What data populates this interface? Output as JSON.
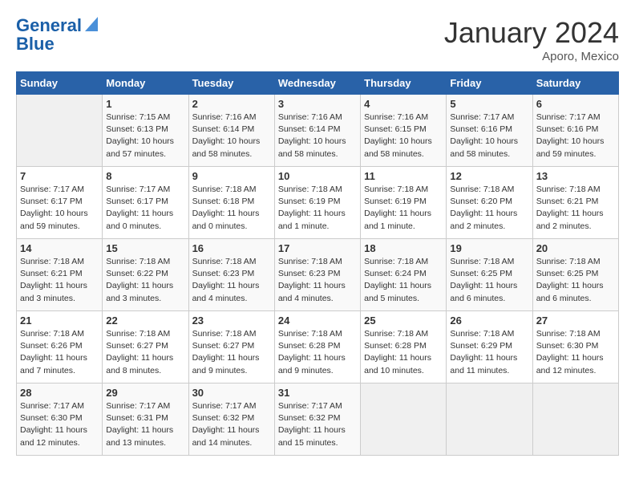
{
  "header": {
    "logo_line1": "General",
    "logo_line2": "Blue",
    "month": "January 2024",
    "location": "Aporo, Mexico"
  },
  "days_of_week": [
    "Sunday",
    "Monday",
    "Tuesday",
    "Wednesday",
    "Thursday",
    "Friday",
    "Saturday"
  ],
  "weeks": [
    [
      {
        "num": "",
        "info": ""
      },
      {
        "num": "1",
        "info": "Sunrise: 7:15 AM\nSunset: 6:13 PM\nDaylight: 10 hours\nand 57 minutes."
      },
      {
        "num": "2",
        "info": "Sunrise: 7:16 AM\nSunset: 6:14 PM\nDaylight: 10 hours\nand 58 minutes."
      },
      {
        "num": "3",
        "info": "Sunrise: 7:16 AM\nSunset: 6:14 PM\nDaylight: 10 hours\nand 58 minutes."
      },
      {
        "num": "4",
        "info": "Sunrise: 7:16 AM\nSunset: 6:15 PM\nDaylight: 10 hours\nand 58 minutes."
      },
      {
        "num": "5",
        "info": "Sunrise: 7:17 AM\nSunset: 6:16 PM\nDaylight: 10 hours\nand 58 minutes."
      },
      {
        "num": "6",
        "info": "Sunrise: 7:17 AM\nSunset: 6:16 PM\nDaylight: 10 hours\nand 59 minutes."
      }
    ],
    [
      {
        "num": "7",
        "info": "Sunrise: 7:17 AM\nSunset: 6:17 PM\nDaylight: 10 hours\nand 59 minutes."
      },
      {
        "num": "8",
        "info": "Sunrise: 7:17 AM\nSunset: 6:17 PM\nDaylight: 11 hours\nand 0 minutes."
      },
      {
        "num": "9",
        "info": "Sunrise: 7:18 AM\nSunset: 6:18 PM\nDaylight: 11 hours\nand 0 minutes."
      },
      {
        "num": "10",
        "info": "Sunrise: 7:18 AM\nSunset: 6:19 PM\nDaylight: 11 hours\nand 1 minute."
      },
      {
        "num": "11",
        "info": "Sunrise: 7:18 AM\nSunset: 6:19 PM\nDaylight: 11 hours\nand 1 minute."
      },
      {
        "num": "12",
        "info": "Sunrise: 7:18 AM\nSunset: 6:20 PM\nDaylight: 11 hours\nand 2 minutes."
      },
      {
        "num": "13",
        "info": "Sunrise: 7:18 AM\nSunset: 6:21 PM\nDaylight: 11 hours\nand 2 minutes."
      }
    ],
    [
      {
        "num": "14",
        "info": "Sunrise: 7:18 AM\nSunset: 6:21 PM\nDaylight: 11 hours\nand 3 minutes."
      },
      {
        "num": "15",
        "info": "Sunrise: 7:18 AM\nSunset: 6:22 PM\nDaylight: 11 hours\nand 3 minutes."
      },
      {
        "num": "16",
        "info": "Sunrise: 7:18 AM\nSunset: 6:23 PM\nDaylight: 11 hours\nand 4 minutes."
      },
      {
        "num": "17",
        "info": "Sunrise: 7:18 AM\nSunset: 6:23 PM\nDaylight: 11 hours\nand 4 minutes."
      },
      {
        "num": "18",
        "info": "Sunrise: 7:18 AM\nSunset: 6:24 PM\nDaylight: 11 hours\nand 5 minutes."
      },
      {
        "num": "19",
        "info": "Sunrise: 7:18 AM\nSunset: 6:25 PM\nDaylight: 11 hours\nand 6 minutes."
      },
      {
        "num": "20",
        "info": "Sunrise: 7:18 AM\nSunset: 6:25 PM\nDaylight: 11 hours\nand 6 minutes."
      }
    ],
    [
      {
        "num": "21",
        "info": "Sunrise: 7:18 AM\nSunset: 6:26 PM\nDaylight: 11 hours\nand 7 minutes."
      },
      {
        "num": "22",
        "info": "Sunrise: 7:18 AM\nSunset: 6:27 PM\nDaylight: 11 hours\nand 8 minutes."
      },
      {
        "num": "23",
        "info": "Sunrise: 7:18 AM\nSunset: 6:27 PM\nDaylight: 11 hours\nand 9 minutes."
      },
      {
        "num": "24",
        "info": "Sunrise: 7:18 AM\nSunset: 6:28 PM\nDaylight: 11 hours\nand 9 minutes."
      },
      {
        "num": "25",
        "info": "Sunrise: 7:18 AM\nSunset: 6:28 PM\nDaylight: 11 hours\nand 10 minutes."
      },
      {
        "num": "26",
        "info": "Sunrise: 7:18 AM\nSunset: 6:29 PM\nDaylight: 11 hours\nand 11 minutes."
      },
      {
        "num": "27",
        "info": "Sunrise: 7:18 AM\nSunset: 6:30 PM\nDaylight: 11 hours\nand 12 minutes."
      }
    ],
    [
      {
        "num": "28",
        "info": "Sunrise: 7:17 AM\nSunset: 6:30 PM\nDaylight: 11 hours\nand 12 minutes."
      },
      {
        "num": "29",
        "info": "Sunrise: 7:17 AM\nSunset: 6:31 PM\nDaylight: 11 hours\nand 13 minutes."
      },
      {
        "num": "30",
        "info": "Sunrise: 7:17 AM\nSunset: 6:32 PM\nDaylight: 11 hours\nand 14 minutes."
      },
      {
        "num": "31",
        "info": "Sunrise: 7:17 AM\nSunset: 6:32 PM\nDaylight: 11 hours\nand 15 minutes."
      },
      {
        "num": "",
        "info": ""
      },
      {
        "num": "",
        "info": ""
      },
      {
        "num": "",
        "info": ""
      }
    ]
  ]
}
